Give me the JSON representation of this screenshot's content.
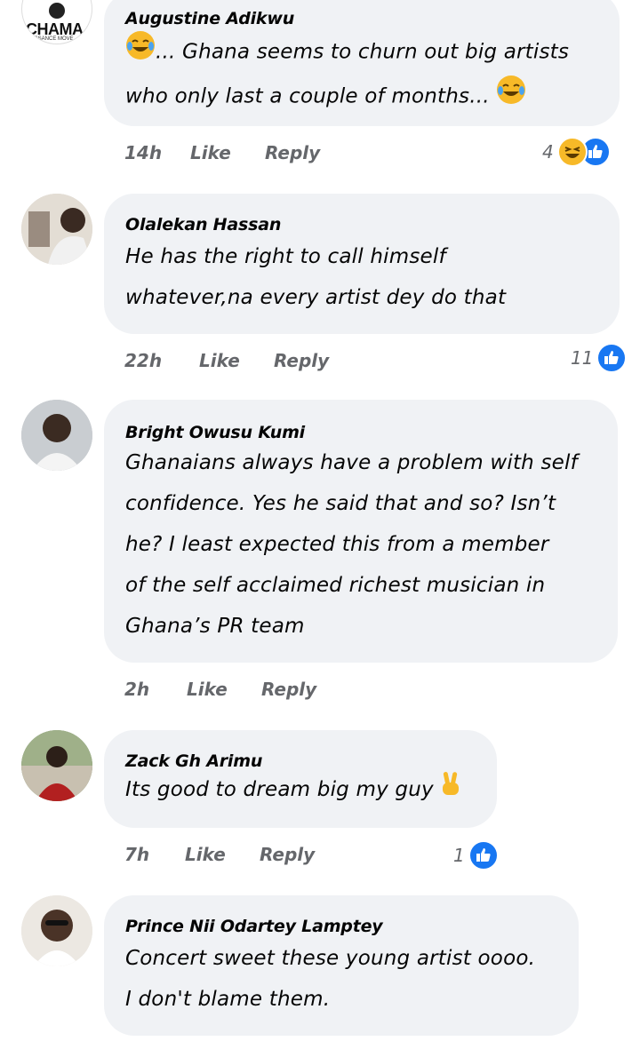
{
  "comments": [
    {
      "author": "Augustine Adikwu",
      "avatar_badge": "CHAMA",
      "avatar_sub": "ISSANCE MOVE",
      "line1": "... Ghana seems to churn out big artists",
      "line2": "who only last a couple of months...",
      "time": "14h",
      "like": "Like",
      "reply": "Reply",
      "reaction_count": "4",
      "reactions": [
        "laughing-emoji",
        "like"
      ]
    },
    {
      "author": "Olalekan Hassan",
      "line1": "He has the right to call himself",
      "line2": "whatever,na every artist dey do that",
      "time": "22h",
      "like": "Like",
      "reply": "Reply",
      "reaction_count": "11",
      "reactions": [
        "like"
      ]
    },
    {
      "author": "Bright Owusu Kumi",
      "lines": [
        "Ghanaians always have a problem with self",
        "confidence. Yes he said that and so? Isn’t",
        "he? I least expected this from a member",
        "of the self acclaimed richest musician in",
        "Ghana’s PR team"
      ],
      "time": "2h",
      "like": "Like",
      "reply": "Reply"
    },
    {
      "author": "Zack Gh Arimu",
      "line1": "Its good to dream big my guy",
      "time": "7h",
      "like": "Like",
      "reply": "Reply",
      "reaction_count": "1",
      "reactions": [
        "like"
      ]
    },
    {
      "author": "Prince Nii Odartey Lamptey",
      "line1": "Concert sweet these young artist oooo.",
      "line2": "I don't blame them."
    }
  ],
  "colors": {
    "bubble": "#f0f2f5",
    "meta": "#65676b",
    "like_blue": "#1877f2",
    "emoji_yellow": "#f7b928"
  }
}
